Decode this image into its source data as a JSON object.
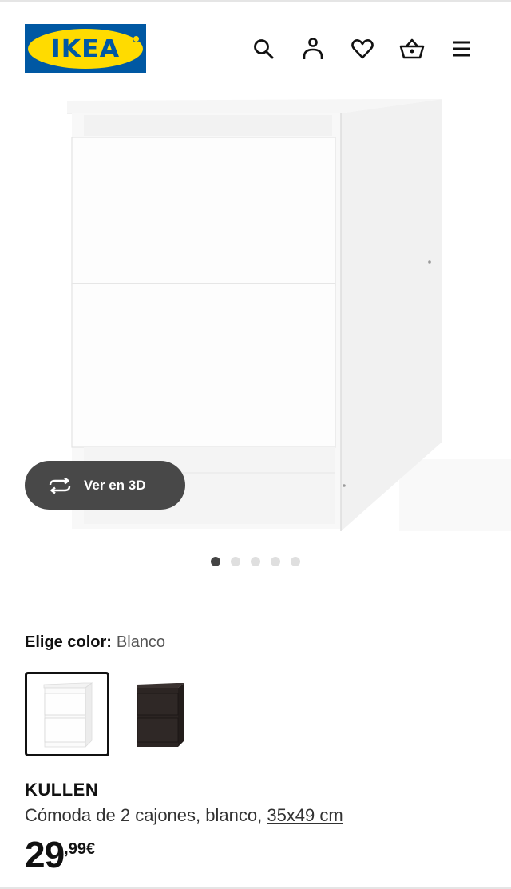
{
  "header": {
    "logo_text": "IKEA",
    "icons": [
      "search-icon",
      "user-icon",
      "heart-icon",
      "basket-icon",
      "menu-icon"
    ]
  },
  "gallery": {
    "view_3d_label": "Ver en 3D",
    "image_count": 5,
    "active_index": 0
  },
  "color_selector": {
    "label": "Elige color:",
    "selected_value": "Blanco",
    "options": [
      "Blanco",
      "Negro-marrón"
    ]
  },
  "product": {
    "name": "KULLEN",
    "description": "Cómoda de 2 cajones, blanco,",
    "size_link": "35x49 cm",
    "price_integer": "29",
    "price_decimal": ",99€"
  },
  "colors": {
    "ikea_blue": "#0058a3",
    "ikea_yellow": "#ffdb00",
    "pill_bg": "#484848",
    "dot_active": "#444444",
    "dot_inactive": "#dfdfdf"
  }
}
